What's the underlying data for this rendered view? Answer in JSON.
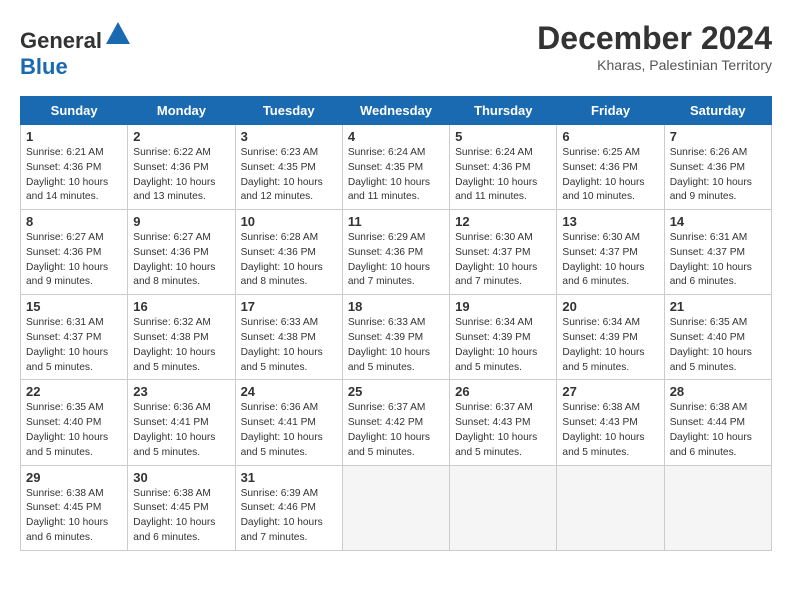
{
  "logo": {
    "general": "General",
    "blue": "Blue"
  },
  "title": "December 2024",
  "location": "Kharas, Palestinian Territory",
  "days_of_week": [
    "Sunday",
    "Monday",
    "Tuesday",
    "Wednesday",
    "Thursday",
    "Friday",
    "Saturday"
  ],
  "weeks": [
    [
      {
        "day": "1",
        "sunrise": "6:21 AM",
        "sunset": "4:36 PM",
        "daylight": "10 hours and 14 minutes."
      },
      {
        "day": "2",
        "sunrise": "6:22 AM",
        "sunset": "4:36 PM",
        "daylight": "10 hours and 13 minutes."
      },
      {
        "day": "3",
        "sunrise": "6:23 AM",
        "sunset": "4:35 PM",
        "daylight": "10 hours and 12 minutes."
      },
      {
        "day": "4",
        "sunrise": "6:24 AM",
        "sunset": "4:35 PM",
        "daylight": "10 hours and 11 minutes."
      },
      {
        "day": "5",
        "sunrise": "6:24 AM",
        "sunset": "4:36 PM",
        "daylight": "10 hours and 11 minutes."
      },
      {
        "day": "6",
        "sunrise": "6:25 AM",
        "sunset": "4:36 PM",
        "daylight": "10 hours and 10 minutes."
      },
      {
        "day": "7",
        "sunrise": "6:26 AM",
        "sunset": "4:36 PM",
        "daylight": "10 hours and 9 minutes."
      }
    ],
    [
      {
        "day": "8",
        "sunrise": "6:27 AM",
        "sunset": "4:36 PM",
        "daylight": "10 hours and 9 minutes."
      },
      {
        "day": "9",
        "sunrise": "6:27 AM",
        "sunset": "4:36 PM",
        "daylight": "10 hours and 8 minutes."
      },
      {
        "day": "10",
        "sunrise": "6:28 AM",
        "sunset": "4:36 PM",
        "daylight": "10 hours and 8 minutes."
      },
      {
        "day": "11",
        "sunrise": "6:29 AM",
        "sunset": "4:36 PM",
        "daylight": "10 hours and 7 minutes."
      },
      {
        "day": "12",
        "sunrise": "6:30 AM",
        "sunset": "4:37 PM",
        "daylight": "10 hours and 7 minutes."
      },
      {
        "day": "13",
        "sunrise": "6:30 AM",
        "sunset": "4:37 PM",
        "daylight": "10 hours and 6 minutes."
      },
      {
        "day": "14",
        "sunrise": "6:31 AM",
        "sunset": "4:37 PM",
        "daylight": "10 hours and 6 minutes."
      }
    ],
    [
      {
        "day": "15",
        "sunrise": "6:31 AM",
        "sunset": "4:37 PM",
        "daylight": "10 hours and 5 minutes."
      },
      {
        "day": "16",
        "sunrise": "6:32 AM",
        "sunset": "4:38 PM",
        "daylight": "10 hours and 5 minutes."
      },
      {
        "day": "17",
        "sunrise": "6:33 AM",
        "sunset": "4:38 PM",
        "daylight": "10 hours and 5 minutes."
      },
      {
        "day": "18",
        "sunrise": "6:33 AM",
        "sunset": "4:39 PM",
        "daylight": "10 hours and 5 minutes."
      },
      {
        "day": "19",
        "sunrise": "6:34 AM",
        "sunset": "4:39 PM",
        "daylight": "10 hours and 5 minutes."
      },
      {
        "day": "20",
        "sunrise": "6:34 AM",
        "sunset": "4:39 PM",
        "daylight": "10 hours and 5 minutes."
      },
      {
        "day": "21",
        "sunrise": "6:35 AM",
        "sunset": "4:40 PM",
        "daylight": "10 hours and 5 minutes."
      }
    ],
    [
      {
        "day": "22",
        "sunrise": "6:35 AM",
        "sunset": "4:40 PM",
        "daylight": "10 hours and 5 minutes."
      },
      {
        "day": "23",
        "sunrise": "6:36 AM",
        "sunset": "4:41 PM",
        "daylight": "10 hours and 5 minutes."
      },
      {
        "day": "24",
        "sunrise": "6:36 AM",
        "sunset": "4:41 PM",
        "daylight": "10 hours and 5 minutes."
      },
      {
        "day": "25",
        "sunrise": "6:37 AM",
        "sunset": "4:42 PM",
        "daylight": "10 hours and 5 minutes."
      },
      {
        "day": "26",
        "sunrise": "6:37 AM",
        "sunset": "4:43 PM",
        "daylight": "10 hours and 5 minutes."
      },
      {
        "day": "27",
        "sunrise": "6:38 AM",
        "sunset": "4:43 PM",
        "daylight": "10 hours and 5 minutes."
      },
      {
        "day": "28",
        "sunrise": "6:38 AM",
        "sunset": "4:44 PM",
        "daylight": "10 hours and 6 minutes."
      }
    ],
    [
      {
        "day": "29",
        "sunrise": "6:38 AM",
        "sunset": "4:45 PM",
        "daylight": "10 hours and 6 minutes."
      },
      {
        "day": "30",
        "sunrise": "6:38 AM",
        "sunset": "4:45 PM",
        "daylight": "10 hours and 6 minutes."
      },
      {
        "day": "31",
        "sunrise": "6:39 AM",
        "sunset": "4:46 PM",
        "daylight": "10 hours and 7 minutes."
      },
      null,
      null,
      null,
      null
    ]
  ]
}
